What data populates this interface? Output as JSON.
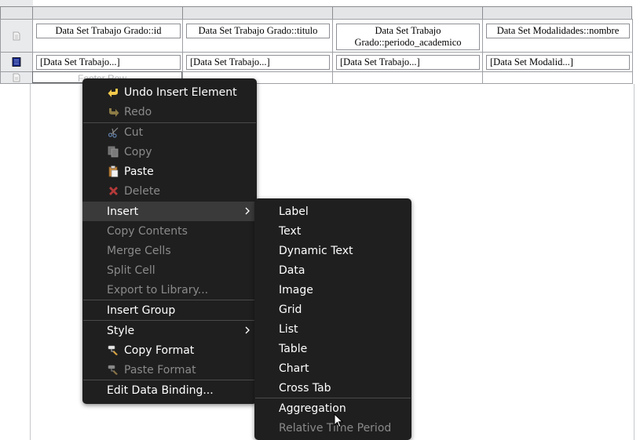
{
  "report": {
    "header_cells": [
      "Data Set Trabajo Grado::id",
      "Data Set Trabajo Grado::titulo",
      "Data Set Trabajo Grado::periodo_academico",
      "Data Set Modalidades::nombre"
    ],
    "detail_cells": [
      "[Data Set Trabajo...]",
      "[Data Set Trabajo...]",
      "[Data Set Trabajo...]",
      "[Data Set Modalid...]"
    ],
    "footer_row_label": "Footer Row"
  },
  "context_menu": {
    "items": [
      {
        "label": "Undo Insert Element",
        "icon": "undo-icon",
        "enabled": true
      },
      {
        "label": "Redo",
        "icon": "redo-icon",
        "enabled": false
      },
      {
        "label": "Cut",
        "icon": "cut-icon",
        "enabled": false
      },
      {
        "label": "Copy",
        "icon": "copy-icon",
        "enabled": false
      },
      {
        "label": "Paste",
        "icon": "paste-icon",
        "enabled": true
      },
      {
        "label": "Delete",
        "icon": "delete-icon",
        "enabled": false
      },
      {
        "label": "Insert",
        "submenu": true,
        "enabled": true
      },
      {
        "label": "Copy Contents",
        "enabled": false
      },
      {
        "label": "Merge Cells",
        "enabled": false
      },
      {
        "label": "Split Cell",
        "enabled": false
      },
      {
        "label": "Export to Library...",
        "enabled": false
      },
      {
        "label": "Insert Group",
        "enabled": true
      },
      {
        "label": "Style",
        "submenu": true,
        "enabled": true
      },
      {
        "label": "Copy Format",
        "icon": "copy-format-icon",
        "enabled": true
      },
      {
        "label": "Paste Format",
        "icon": "paste-format-icon",
        "enabled": false
      },
      {
        "label": "Edit Data Binding...",
        "enabled": true
      }
    ]
  },
  "insert_submenu": {
    "items": [
      {
        "label": "Label",
        "enabled": true
      },
      {
        "label": "Text",
        "enabled": true
      },
      {
        "label": "Dynamic Text",
        "enabled": true
      },
      {
        "label": "Data",
        "enabled": true
      },
      {
        "label": "Image",
        "enabled": true
      },
      {
        "label": "Grid",
        "enabled": true
      },
      {
        "label": "List",
        "enabled": true
      },
      {
        "label": "Table",
        "enabled": true
      },
      {
        "label": "Chart",
        "enabled": true
      },
      {
        "label": "Cross Tab",
        "enabled": true
      },
      {
        "label": "Aggregation",
        "enabled": true
      },
      {
        "label": "Relative Time Period",
        "enabled": false
      }
    ]
  },
  "colors": {
    "menu_bg": "#1f1f1f",
    "menu_highlight": "#3a3a3a",
    "menu_disabled": "#8a8a8a",
    "detail_row_icon": "#1a2a8a"
  }
}
